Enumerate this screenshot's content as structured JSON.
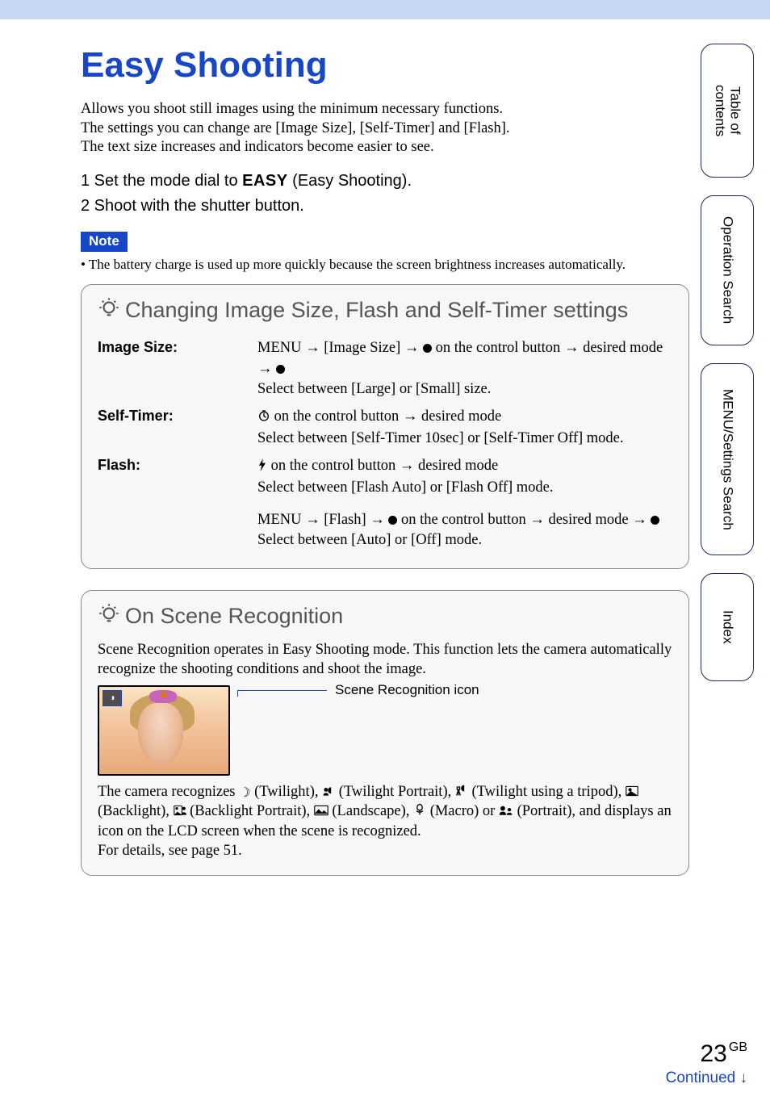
{
  "title": "Easy Shooting",
  "intro": "Allows you shoot still images using the minimum necessary functions.\nThe settings you can change are [Image Size], [Self-Timer] and [Flash].\nThe text size increases and indicators become easier to see.",
  "steps": {
    "s1_prefix": "1 Set the mode dial to ",
    "s1_easy": "EASY",
    "s1_suffix": " (Easy Shooting).",
    "s2": "2 Shoot with the shutter button."
  },
  "note_label": "Note",
  "note_body": "The battery charge is used up more quickly because the screen brightness increases automatically.",
  "tip1_title": "Changing Image Size, Flash and Self-Timer settings",
  "settings": {
    "image_size": {
      "label": "Image Size:",
      "line1a": "MENU ",
      "line1b": " [Image Size] ",
      "line1c": " on the control button ",
      "line1d": " desired mode ",
      "line2": "Select between [Large] or [Small] size."
    },
    "self_timer": {
      "label": "Self-Timer:",
      "line1a": " on the control button ",
      "line1b": " desired mode",
      "line2": "Select between [Self-Timer 10sec] or [Self-Timer Off] mode."
    },
    "flash": {
      "label": "Flash:",
      "line1a": " on the control button ",
      "line1b": " desired mode",
      "line2": "Select between [Flash Auto] or [Flash Off] mode.",
      "line3a": "MENU ",
      "line3b": " [Flash] ",
      "line3c": " on the control button ",
      "line3d": " desired mode ",
      "line4": "Select between [Auto] or [Off] mode."
    }
  },
  "tip2_title": "On Scene Recognition",
  "scene_intro": "Scene Recognition operates in Easy Shooting mode. This function lets the camera automatically recognize the shooting conditions and shoot the image.",
  "scene_icon_label": "Scene Recognition icon",
  "scene_desc_parts": {
    "p1": "The camera recognizes ",
    "twilight": " (Twilight), ",
    "twilight_portrait": " (Twilight Portrait), ",
    "twilight_tripod": " (Twilight using a tripod), ",
    "backlight": " (Backlight), ",
    "backlight_portrait": " (Backlight Portrait), ",
    "landscape": " (Landscape), ",
    "macro": " (Macro) or ",
    "portrait": " (Portrait), and displays an icon on the LCD screen when the scene is recognized.",
    "details": "For details, see page 51."
  },
  "side_tabs": {
    "toc": "Table of\ncontents",
    "op": "Operation\nSearch",
    "menu": "MENU/Settings\nSearch",
    "index": "Index"
  },
  "footer": {
    "page": "23",
    "gb": "GB",
    "continued": "Continued "
  }
}
